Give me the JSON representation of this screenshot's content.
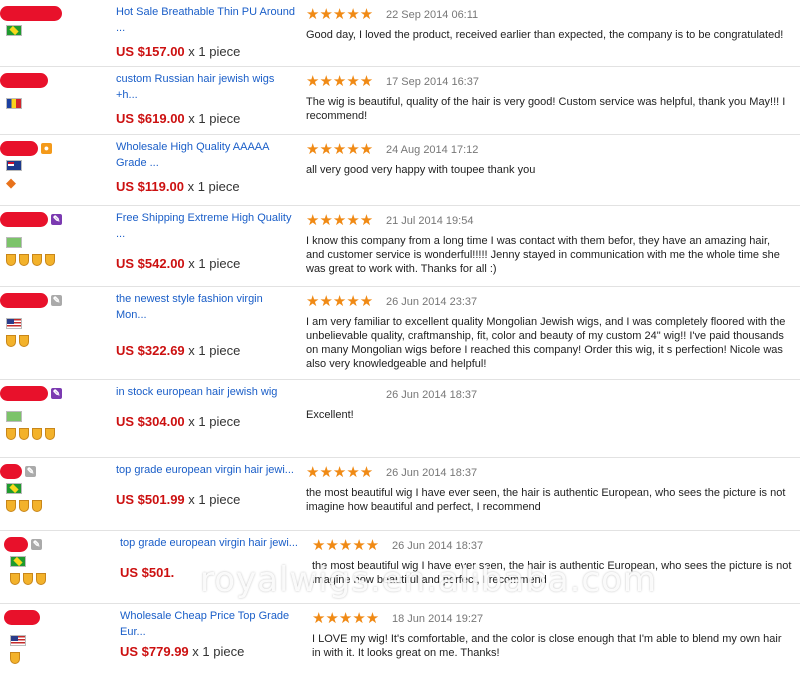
{
  "rows": [
    {
      "product": "Hot Sale Breathable Thin PU Around ...",
      "price": "US $157.00",
      "qty": "x 1 piece",
      "date": "22 Sep 2014 06:11",
      "review": "Good day, I loved the product, received earlier than expected, the company is to be congratulated!",
      "stars": 5
    },
    {
      "product": "custom Russian hair jewish wigs +h...",
      "price": "US $619.00",
      "qty": "x 1 piece",
      "date": "17 Sep 2014 16:37",
      "review": "The wig is beautiful, quality of the hair is very good! Custom service was helpful, thank you May!!! I recommend!",
      "stars": 5
    },
    {
      "product": "Wholesale High Quality AAAAA Grade ...",
      "price": "US $119.00",
      "qty": "x 1 piece",
      "date": "24 Aug 2014 17:12",
      "review": "all very good very happy with toupee thank you",
      "stars": 5
    },
    {
      "product": "Free Shipping Extreme High Quality ...",
      "price": "US $542.00",
      "qty": "x 1 piece",
      "date": "21 Jul 2014 19:54",
      "review": "I know this company from a long time I was contact with them befor, they have an amazing hair, and customer service is wonderful!!!!! Jenny stayed in communication with me the whole time she was great to work with. Thanks for all :)",
      "stars": 5
    },
    {
      "product": "the newest style fashion virgin Mon...",
      "price": "US $322.69",
      "qty": "x 1 piece",
      "date": "26 Jun 2014 23:37",
      "review": "I am very familiar to excellent quality Mongolian Jewish wigs, and I was completely floored with the unbelievable quality, craftmanship, fit, color and beauty of my custom 24\" wig!! I've paid thousands on many Mongolian wigs before I reached this company! Order this wig, it s perfection! Nicole was also very knowledgeable and helpful!",
      "stars": 5
    },
    {
      "product": "in stock european hair jewish wig",
      "price": "US $304.00",
      "qty": "x 1 piece",
      "date": "26 Jun 2014 18:37",
      "review": "Excellent!",
      "stars": 0
    },
    {
      "product": "top grade european virgin hair jewi...",
      "price": "US $501.99",
      "qty": "x 1 piece",
      "date": "26 Jun 2014 18:37",
      "review": "the most beautiful wig I have ever seen, the hair is authentic European, who sees the picture is not imagine how beautiful and perfect, I recommend",
      "stars": 5
    },
    {
      "product": "top grade european virgin hair jewi...",
      "price": "US $501.",
      "qty": "",
      "date": "26 Jun 2014 18:37",
      "review": "the most beautiful wig I have ever seen, the hair is authentic European, who sees the picture is not imagine how beautiful and perfect, I recommend",
      "stars": 5
    },
    {
      "product": "Wholesale Cheap Price Top Grade Eur...",
      "price": "US $779.99",
      "qty": "x 1 piece",
      "date": "18 Jun 2014 19:27",
      "review": "I LOVE my wig! It's comfortable, and the color is close enough that I'm able to blend my own hair in with it. It looks great on me. Thanks!",
      "stars": 5
    }
  ],
  "star_glyphs": "★★★★★",
  "watermark": "royalwigs.en.alibaba.com",
  "colors": {
    "price": "#cc1010",
    "link": "#1a5ec8",
    "stars": "#f08a15",
    "name_mask": "#e8112b"
  }
}
